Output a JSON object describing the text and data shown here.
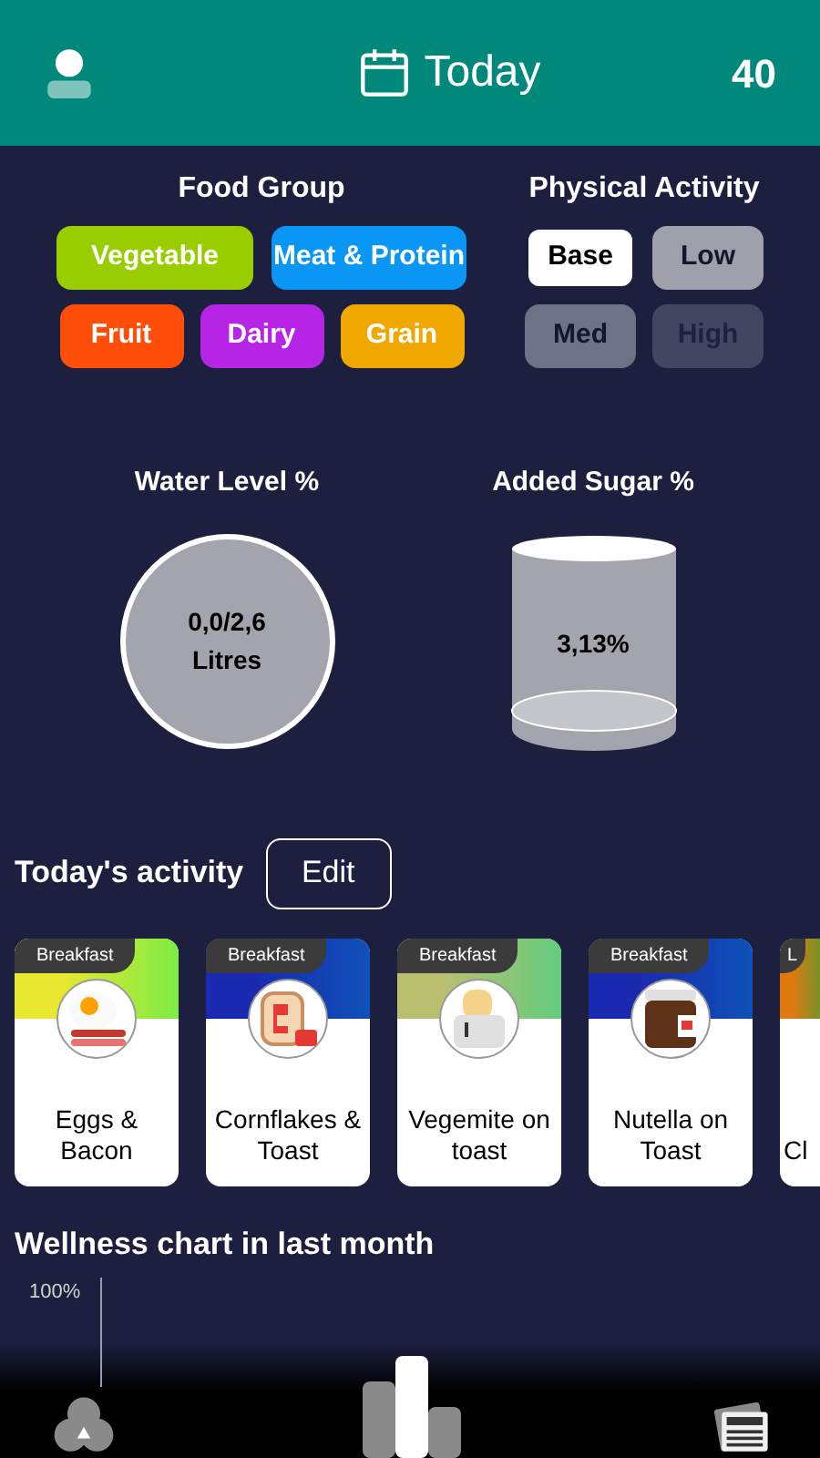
{
  "header": {
    "title": "Today",
    "count": "40"
  },
  "food_group": {
    "title": "Food Group",
    "items": [
      {
        "label": "Vegetable",
        "color": "#9acd00"
      },
      {
        "label": "Meat & Protein",
        "color": "#0a96f5"
      },
      {
        "label": "Fruit",
        "color": "#ff4d0a"
      },
      {
        "label": "Dairy",
        "color": "#b624e6"
      },
      {
        "label": "Grain",
        "color": "#f0a800"
      }
    ]
  },
  "physical_activity": {
    "title": "Physical Activity",
    "items": [
      {
        "label": "Base",
        "selected": true,
        "color": "#ffffff"
      },
      {
        "label": "Low",
        "selected": false,
        "color": "#9fa0ab"
      },
      {
        "label": "Med",
        "selected": false,
        "color": "#6f7185"
      },
      {
        "label": "High",
        "selected": false,
        "color": "#434660"
      }
    ]
  },
  "water": {
    "title": "Water Level %",
    "value": "0,0/2,6",
    "unit": "Litres"
  },
  "sugar": {
    "title": "Added Sugar %",
    "value": "3,13%"
  },
  "activity": {
    "title": "Today's activity",
    "edit": "Edit",
    "cards": [
      {
        "meal": "Breakfast",
        "name": "Eggs & Bacon",
        "kind": "eggs",
        "color": "#e8e830"
      },
      {
        "meal": "Breakfast",
        "name": "Cornflakes & Toast",
        "kind": "toast",
        "color": "#1a2ab0"
      },
      {
        "meal": "Breakfast",
        "name": "Vegemite on toast",
        "kind": "toaster",
        "color": "#b8c070"
      },
      {
        "meal": "Breakfast",
        "name": "Nutella on Toast",
        "kind": "jar",
        "color": "#1a2ab0"
      },
      {
        "meal": "L",
        "name": "Cl",
        "kind": "cut",
        "color": "#e07a10"
      }
    ]
  },
  "wellness": {
    "title": "Wellness chart in last month",
    "tick": "100%"
  },
  "nav": [
    {
      "kind": "circles",
      "selected": false
    },
    {
      "kind": "bars",
      "selected": true
    },
    {
      "kind": "news",
      "selected": false
    }
  ]
}
